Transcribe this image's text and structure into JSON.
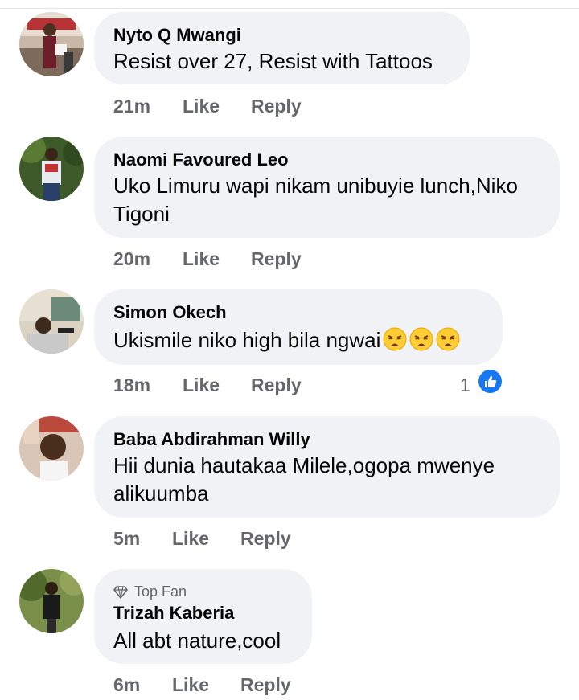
{
  "comments": [
    {
      "author": "Nyto Q Mwangi",
      "text": "Resist over 27, Resist with Tattoos",
      "time": "21m",
      "like_label": "Like",
      "reply_label": "Reply"
    },
    {
      "author": "Naomi Favoured Leo",
      "text_line1": "Uko Limuru wapi nikam unibuyie lunch,Niko",
      "text_line2": "Tigoni",
      "time": "20m",
      "like_label": "Like",
      "reply_label": "Reply"
    },
    {
      "author": "Simon Okech",
      "text": "Ukismile niko high bila ngwai",
      "emojis": [
        "weary-face-emoji",
        "weary-face-emoji",
        "weary-face-emoji"
      ],
      "time": "18m",
      "like_label": "Like",
      "reply_label": "Reply",
      "reaction_count": "1",
      "reaction_icon": "thumbs-up-icon"
    },
    {
      "author": "Baba Abdirahman Willy",
      "text_line1": "Hii dunia hautakaa Milele,ogopa mwenye",
      "text_line2": "alikuumba",
      "time": "5m",
      "like_label": "Like",
      "reply_label": "Reply"
    },
    {
      "author": "Trizah Kaberia",
      "badge": "Top Fan",
      "badge_icon": "diamond-icon",
      "text": "All abt nature,cool",
      "time": "6m",
      "like_label": "Like",
      "reply_label": "Reply"
    }
  ],
  "colors": {
    "bubble": "#f0f2f5",
    "meta_text": "#65676b",
    "like_blue": "#1877f2"
  }
}
